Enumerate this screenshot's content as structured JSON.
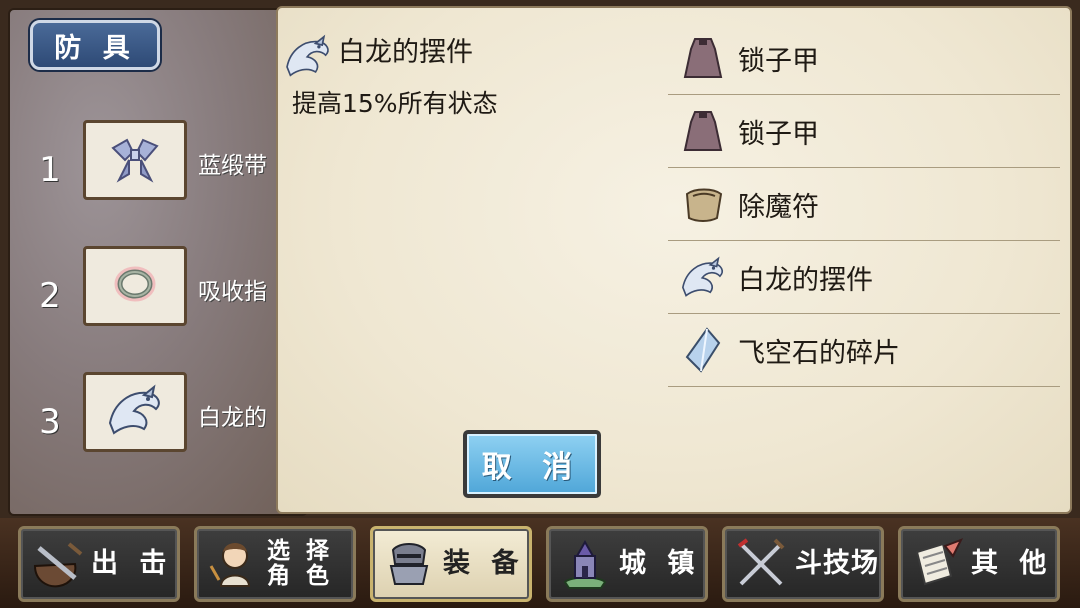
{
  "category_tab": "防 具",
  "slots": [
    {
      "number": "1",
      "name": "蓝缎带",
      "icon": "ribbon-icon"
    },
    {
      "number": "2",
      "name": "吸收指",
      "icon": "ring-icon"
    },
    {
      "number": "3",
      "name": "白龙的",
      "icon": "white-dragon-icon"
    }
  ],
  "detail": {
    "title": "白龙的摆件",
    "description": "提高15%所有状态",
    "icon": "white-dragon-icon"
  },
  "item_list": [
    {
      "label": "锁子甲",
      "icon": "chainmail-icon"
    },
    {
      "label": "锁子甲",
      "icon": "chainmail-icon"
    },
    {
      "label": "除魔符",
      "icon": "charm-icon"
    },
    {
      "label": "白龙的摆件",
      "icon": "white-dragon-icon"
    },
    {
      "label": "飞空石的碎片",
      "icon": "crystal-shard-icon"
    }
  ],
  "cancel_label": "取 消",
  "nav": [
    {
      "label": "出 击",
      "icon": "sortie-icon",
      "active": false
    },
    {
      "label": "选 择\n角 色",
      "icon": "character-icon",
      "active": false
    },
    {
      "label": "装 备",
      "icon": "equipment-icon",
      "active": true
    },
    {
      "label": "城 镇",
      "icon": "town-icon",
      "active": false
    },
    {
      "label": "斗技场",
      "icon": "arena-icon",
      "active": false
    },
    {
      "label": "其 他",
      "icon": "other-icon",
      "active": false
    }
  ],
  "colors": {
    "cancel_button": "#5fb3e0",
    "active_nav": "#efe6c8",
    "tab": "#3a5a88"
  }
}
